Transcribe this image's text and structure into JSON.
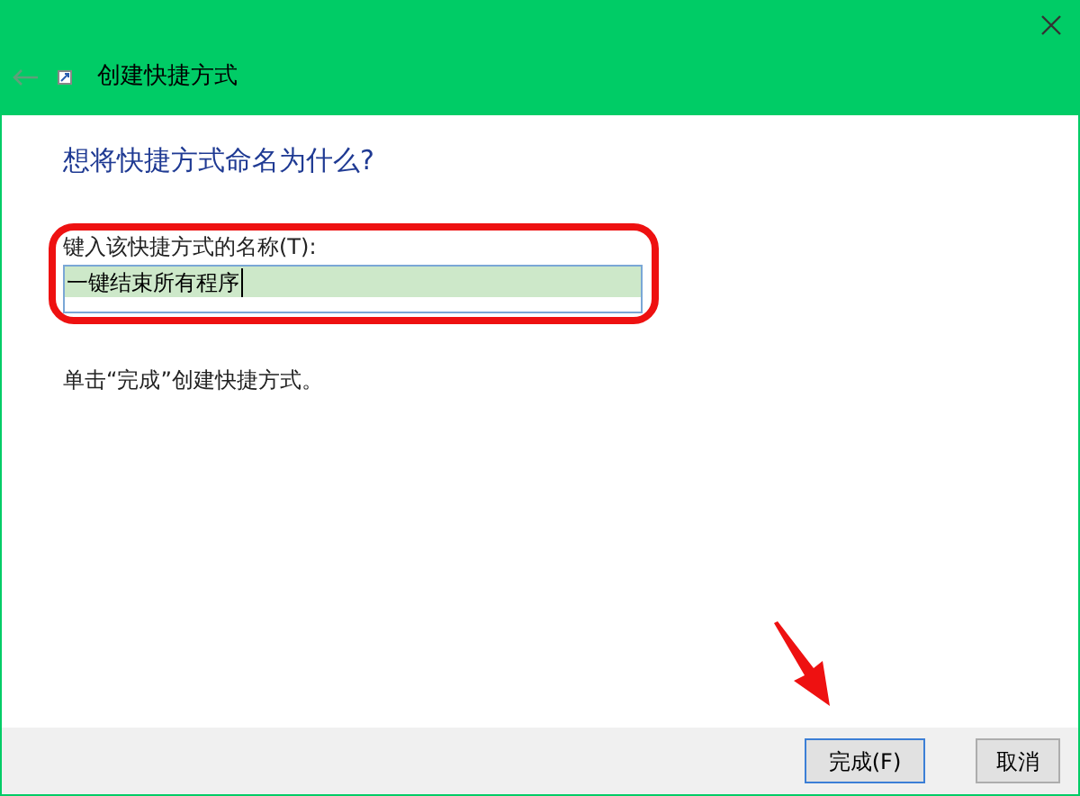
{
  "window": {
    "title": "创建快捷方式"
  },
  "heading": "想将快捷方式命名为什么?",
  "name_field": {
    "label": "键入该快捷方式的名称(T):",
    "value": "一键结束所有程序",
    "text_selected": true
  },
  "instruction": "单击“完成”创建快捷方式。",
  "buttons": [
    {
      "label": "完成(F)",
      "default": true
    },
    {
      "label": "取消",
      "default": false
    }
  ]
}
